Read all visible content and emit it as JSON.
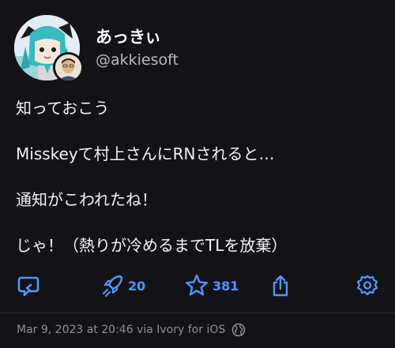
{
  "author": {
    "display_name": "あっきぃ",
    "handle": "@akkiesoft"
  },
  "post": {
    "lines": [
      "知っておこう",
      "Misskeyて村上さんにRNされると…",
      "通知がこわれたね！",
      "じゃ！（熱りが冷めるまでTLを放棄）"
    ]
  },
  "actions": {
    "reply_icon": "reply-icon",
    "boost_icon": "rocket-boost-icon",
    "boost_count": "20",
    "favorite_icon": "star-icon",
    "favorite_count": "381",
    "share_icon": "share-icon",
    "more_icon": "gear-icon"
  },
  "footer": {
    "timestamp": "Mar 9, 2023 at 20:46 via Ivory for iOS",
    "visibility_icon": "globe-icon"
  },
  "colors": {
    "background": "#131217",
    "accent": "#4d96ff",
    "text_primary": "#ffffff",
    "text_secondary": "#b9b9bf",
    "text_muted": "#8e8e95"
  }
}
